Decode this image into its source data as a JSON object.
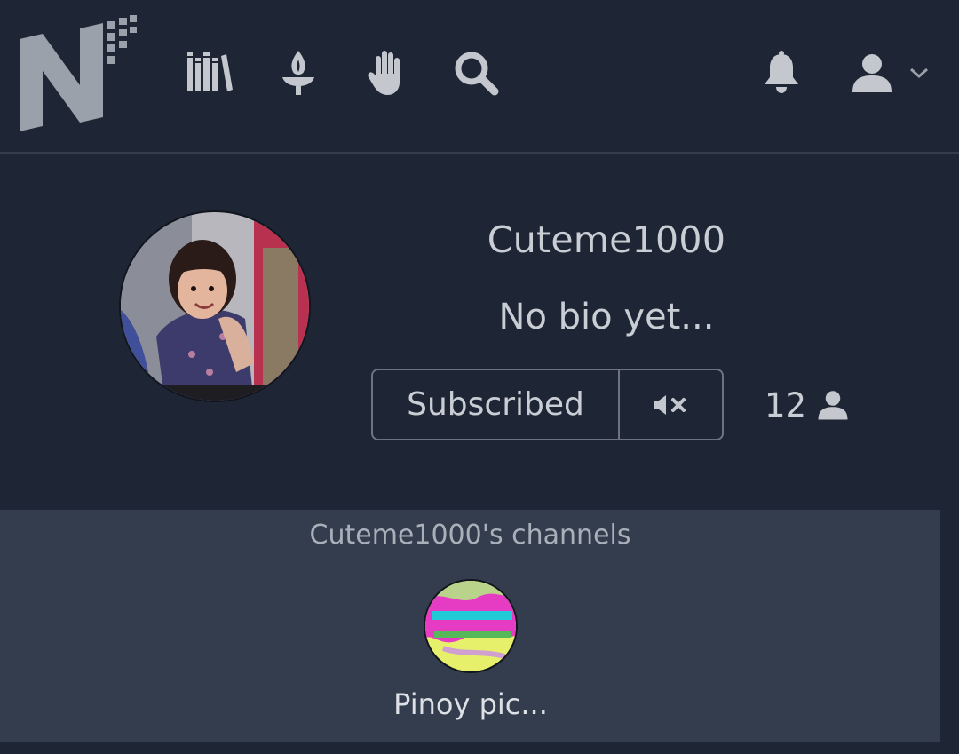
{
  "brand": {
    "logo_icon": "n-logo-icon",
    "accent": "#9aa1ab"
  },
  "nav": {
    "items": [
      {
        "name": "library-icon"
      },
      {
        "name": "torch-icon"
      },
      {
        "name": "hand-icon"
      },
      {
        "name": "search-icon"
      }
    ],
    "right": [
      {
        "name": "bell-icon"
      },
      {
        "name": "user-icon"
      },
      {
        "name": "chevron-down-icon"
      }
    ]
  },
  "profile": {
    "username": "Cuteme1000",
    "bio": "No bio yet...",
    "subscribe_label": "Subscribed",
    "mute_icon": "mute-icon",
    "subscriber_count": "12",
    "subscriber_icon": "user-icon"
  },
  "channels": {
    "title": "Cuteme1000's channels",
    "items": [
      {
        "name": "Pinoy pic...",
        "thumb_icon": "channel-thumbnail"
      }
    ]
  },
  "colors": {
    "background": "#1e2534",
    "panel": "#343d4e",
    "text": "#c9cdd4",
    "border": "#6d7480"
  }
}
